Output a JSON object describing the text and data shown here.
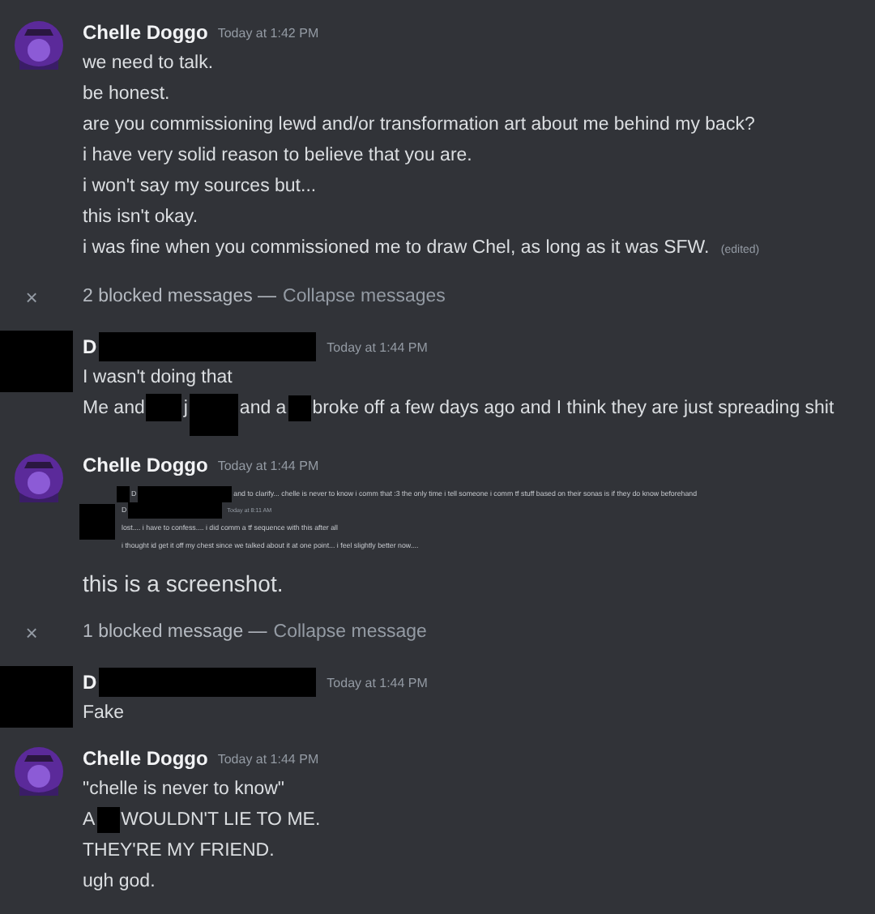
{
  "chat": [
    {
      "kind": "message",
      "avatar": {
        "kind": "picture"
      },
      "author": [
        {
          "kind": "text",
          "text": "Chelle Doggo"
        }
      ],
      "timestamp": "Today at 1:42 PM",
      "content": [
        {
          "kind": "line",
          "segments": [
            {
              "kind": "text",
              "text": "we need to talk."
            }
          ]
        },
        {
          "kind": "line",
          "segments": [
            {
              "kind": "text",
              "text": "be honest."
            }
          ]
        },
        {
          "kind": "line",
          "segments": [
            {
              "kind": "text",
              "text": "are you commissioning lewd and/or transformation art about me behind my back?"
            }
          ]
        },
        {
          "kind": "line",
          "segments": [
            {
              "kind": "text",
              "text": "i have very solid reason to believe that you are."
            }
          ]
        },
        {
          "kind": "line",
          "segments": [
            {
              "kind": "text",
              "text": "i won't say my sources but..."
            }
          ]
        },
        {
          "kind": "line",
          "segments": [
            {
              "kind": "text",
              "text": "this isn't okay."
            }
          ]
        },
        {
          "kind": "line",
          "segments": [
            {
              "kind": "text",
              "text": "i was fine when you commissioned me to draw Chel, as long as it was SFW."
            }
          ],
          "edited": "(edited)"
        }
      ]
    },
    {
      "kind": "blocked",
      "close": "×",
      "label": "2 blocked messages —",
      "link": "Collapse messages"
    },
    {
      "kind": "message",
      "avatar": {
        "kind": "redacted"
      },
      "author": [
        {
          "kind": "text",
          "text": "D"
        },
        {
          "kind": "redaction-name"
        }
      ],
      "timestamp": "Today at 1:44 PM",
      "content": [
        {
          "kind": "line",
          "segments": [
            {
              "kind": "text",
              "text": "I wasn't doing that"
            }
          ]
        },
        {
          "kind": "line",
          "segments": [
            {
              "kind": "text",
              "text": "Me and"
            },
            {
              "kind": "redaction-word"
            },
            {
              "kind": "text",
              "text": "j"
            },
            {
              "kind": "redaction-tall"
            },
            {
              "kind": "text",
              "text": "and a"
            },
            {
              "kind": "redaction-letter"
            },
            {
              "kind": "text",
              "text": "broke off a few days ago and I think they are just spreading shit"
            }
          ]
        }
      ]
    },
    {
      "kind": "message",
      "avatar": {
        "kind": "picture"
      },
      "author": [
        {
          "kind": "text",
          "text": "Chelle Doggo"
        }
      ],
      "timestamp": "Today at 1:44 PM",
      "content": [
        {
          "kind": "screenshot",
          "reply": [
            {
              "kind": "redaction-tiny"
            },
            {
              "kind": "text",
              "text": "D"
            },
            {
              "kind": "redaction-short"
            },
            {
              "kind": "text",
              "text": "and to clarify... chelle is never to know i comm that :3 the only time i tell someone i comm tf stuff based on their sonas is if they do know beforehand"
            }
          ],
          "author": [
            {
              "kind": "text",
              "text": "D"
            },
            {
              "kind": "redaction-short"
            }
          ],
          "timestamp": "Today at 8:11 AM",
          "lines": [
            "lost.... i have to confess.... i did comm a tf sequence with this after all",
            "i thought id get it off my chest since we talked about it at one point... i feel slightly better now...."
          ]
        },
        {
          "kind": "big-line",
          "segments": [
            {
              "kind": "text",
              "text": "this is a screenshot."
            }
          ]
        }
      ]
    },
    {
      "kind": "blocked",
      "close": "×",
      "label": "1 blocked message —",
      "link": "Collapse message"
    },
    {
      "kind": "message",
      "avatar": {
        "kind": "redacted"
      },
      "author": [
        {
          "kind": "text",
          "text": "D"
        },
        {
          "kind": "redaction-name"
        }
      ],
      "timestamp": "Today at 1:44 PM",
      "content": [
        {
          "kind": "line",
          "segments": [
            {
              "kind": "text",
              "text": "Fake"
            }
          ]
        }
      ]
    },
    {
      "kind": "message",
      "avatar": {
        "kind": "picture"
      },
      "author": [
        {
          "kind": "text",
          "text": "Chelle Doggo"
        }
      ],
      "timestamp": "Today at 1:44 PM",
      "content": [
        {
          "kind": "line",
          "segments": [
            {
              "kind": "text",
              "text": "\"chelle is never to know\""
            }
          ]
        },
        {
          "kind": "line",
          "segments": [
            {
              "kind": "text",
              "text": "A"
            },
            {
              "kind": "redaction-letter"
            },
            {
              "kind": "text",
              "text": "WOULDN'T LIE TO ME."
            }
          ]
        },
        {
          "kind": "line",
          "segments": [
            {
              "kind": "text",
              "text": "THEY'RE MY FRIEND."
            }
          ]
        },
        {
          "kind": "line",
          "segments": [
            {
              "kind": "text",
              "text": "ugh god."
            }
          ]
        }
      ]
    }
  ]
}
